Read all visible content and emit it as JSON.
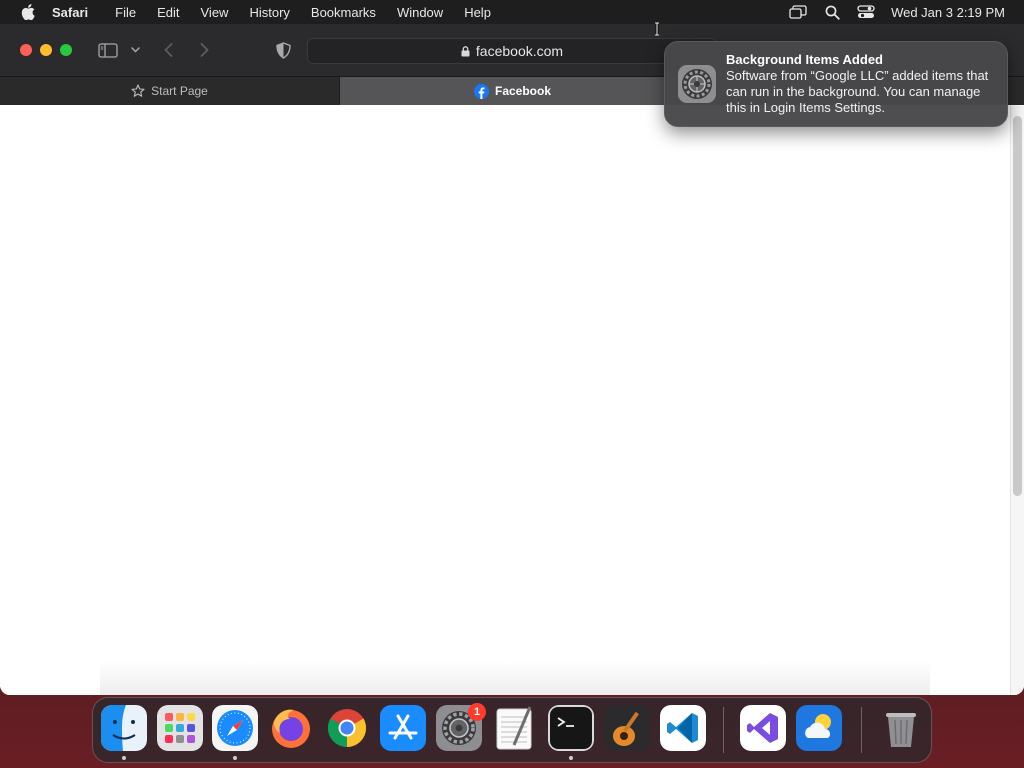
{
  "menubar": {
    "app_name": "Safari",
    "items": [
      "File",
      "Edit",
      "View",
      "History",
      "Bookmarks",
      "Window",
      "Help"
    ],
    "clock": "Wed Jan 3  2:19 PM",
    "status_icons": [
      "screen-mirroring-icon",
      "spotlight-search-icon",
      "control-center-icon"
    ]
  },
  "safari": {
    "address": "facebook.com",
    "tabs": [
      {
        "label": "Start Page",
        "icon": "star-icon",
        "active": false
      },
      {
        "label": "Facebook",
        "icon": "facebook-icon",
        "active": true
      }
    ]
  },
  "notification": {
    "title": "Background Items Added",
    "body": "Software from “Google LLC” added items that can run in the background. You can manage this in Login Items Settings.",
    "icon": "system-settings-icon"
  },
  "dock": {
    "apps": [
      "Finder",
      "Launchpad",
      "Safari",
      "Firefox",
      "Google Chrome",
      "App Store",
      "System Settings",
      "TextEdit",
      "Terminal",
      "GarageBand",
      "Visual Studio Code",
      "Visual Studio",
      "Weather",
      "Trash"
    ],
    "settings_badge": "1",
    "accent": "#ff3b30"
  }
}
